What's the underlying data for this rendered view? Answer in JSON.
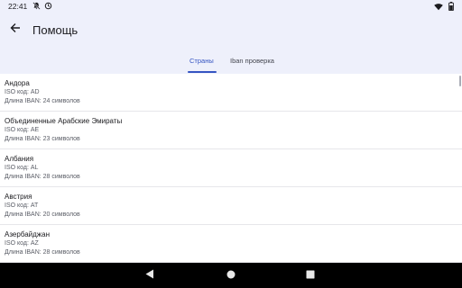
{
  "status_bar": {
    "time": "22:41",
    "left_icons": [
      "notification-muted-icon",
      "data-saver-icon"
    ],
    "right_icons": [
      "wifi-icon",
      "battery-icon"
    ]
  },
  "app_bar": {
    "title": "Помощь",
    "back_icon": "arrow-back-icon"
  },
  "tabs": [
    {
      "label": "Страны",
      "selected": true
    },
    {
      "label": "Iban проверка",
      "selected": false
    }
  ],
  "countries": [
    {
      "name": "Андора",
      "iso": "ISO код: AD",
      "iban": "Длина IBAN: 24 символов"
    },
    {
      "name": "Объединенные Арабские Эмираты",
      "iso": "ISO код: AE",
      "iban": "Длина IBAN: 23 символов"
    },
    {
      "name": "Албания",
      "iso": "ISO код: AL",
      "iban": "Длина IBAN: 28 символов"
    },
    {
      "name": "Австрия",
      "iso": "ISO код: AT",
      "iban": "Длина IBAN: 20 символов"
    },
    {
      "name": "Азербайджан",
      "iso": "ISO код: AZ",
      "iban": "Длина IBAN: 28 символов"
    }
  ],
  "nav_bar": {
    "buttons": [
      "nav-back-icon",
      "nav-home-icon",
      "nav-recents-icon"
    ]
  },
  "colors": {
    "header_bg": "#eef0fb",
    "accent": "#3554c2",
    "nav_bg": "#000000"
  }
}
